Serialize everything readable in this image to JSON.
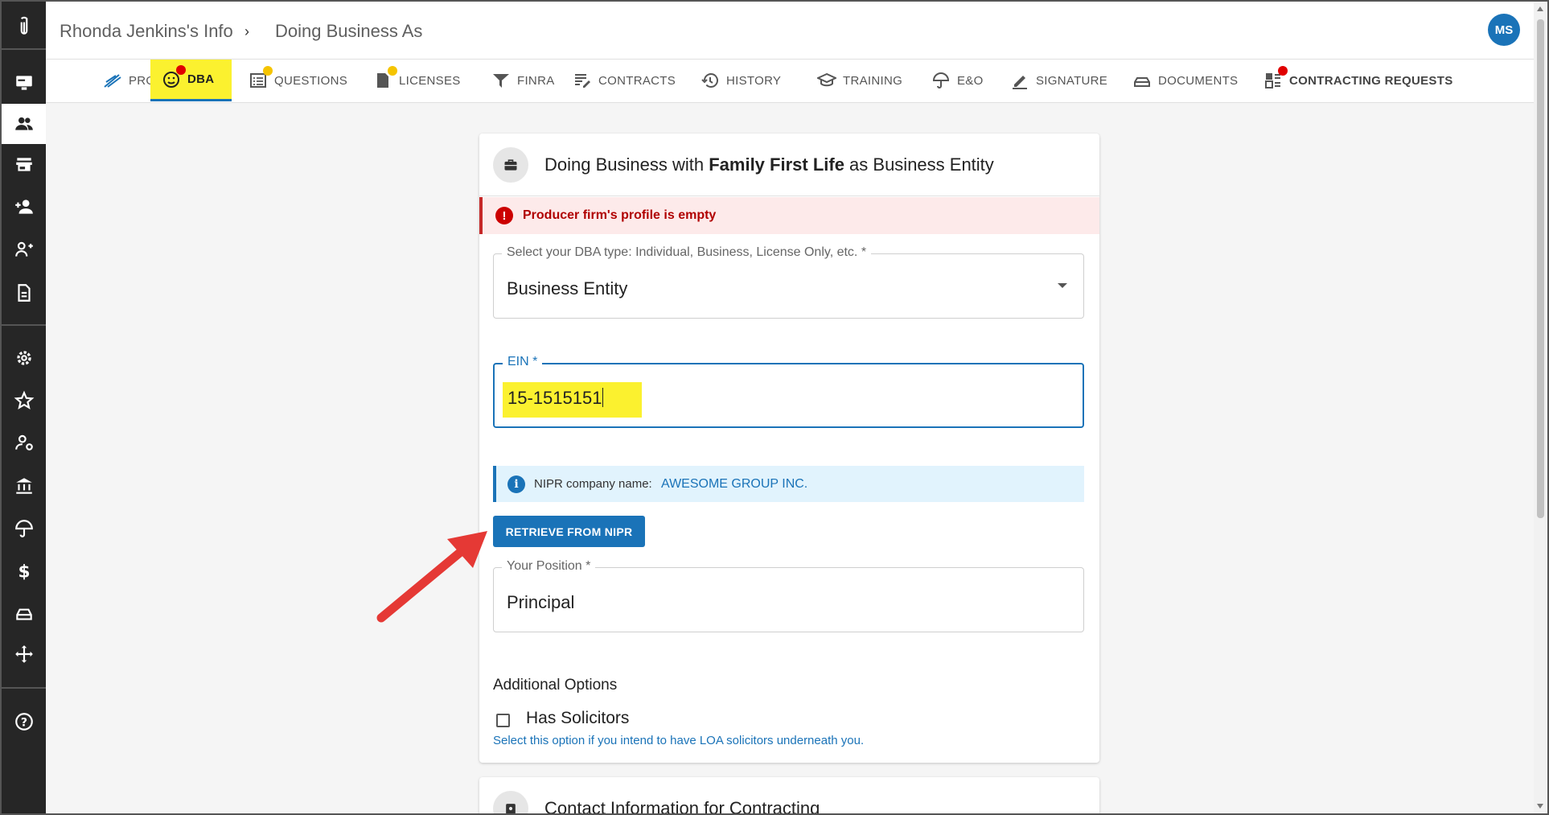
{
  "header": {
    "breadcrumb_parent": "Rhonda Jenkins's Info",
    "breadcrumb_separator": "›",
    "breadcrumb_current": "Doing Business As",
    "avatar_initials": "MS"
  },
  "tabs": [
    {
      "label": "PROFILE",
      "icon": "profile-icon"
    },
    {
      "label": "DBA",
      "icon": "dba-icon",
      "active": true,
      "badge": "red"
    },
    {
      "label": "QUESTIONS",
      "icon": "questions-icon",
      "badge": "yellow"
    },
    {
      "label": "LICENSES",
      "icon": "licenses-icon",
      "badge": "yellow"
    },
    {
      "label": "FINRA",
      "icon": "finra-icon"
    },
    {
      "label": "CONTRACTS",
      "icon": "contracts-icon"
    },
    {
      "label": "HISTORY",
      "icon": "history-icon"
    },
    {
      "label": "TRAINING",
      "icon": "training-icon"
    },
    {
      "label": "E&O",
      "icon": "umbrella-icon"
    },
    {
      "label": "SIGNATURE",
      "icon": "signature-icon"
    },
    {
      "label": "DOCUMENTS",
      "icon": "documents-icon"
    },
    {
      "label": "CONTRACTING REQUESTS",
      "icon": "contracting-requests-icon",
      "badge": "red"
    }
  ],
  "sidebar": {
    "items": [
      "logo-icon",
      "dashboard-icon",
      "people-icon",
      "store-icon",
      "add-person-icon",
      "group-add-icon",
      "document-icon",
      "settings-icon",
      "star-icon",
      "user-settings-icon",
      "bank-icon",
      "umbrella-icon",
      "dollar-icon",
      "inbox-icon",
      "move-icon",
      "help-icon"
    ]
  },
  "dba_card": {
    "title_prefix": "Doing Business with ",
    "title_bold": "Family First Life",
    "title_suffix": " as Business Entity",
    "error_text": "Producer firm's profile is empty",
    "dba_type_label": "Select your DBA type: Individual, Business, License Only, etc. *",
    "dba_type_value": "Business Entity",
    "ein_label": "EIN *",
    "ein_value": "15-1515151",
    "nipr_label": "NIPR company name:",
    "nipr_value": "AWESOME GROUP INC.",
    "retrieve_button": "RETRIEVE FROM NIPR",
    "position_label": "Your Position *",
    "position_value": "Principal",
    "additional_title": "Additional Options",
    "has_solicitors_label": "Has Solicitors",
    "has_solicitors_checked": false,
    "has_solicitors_hint": "Select this option if you intend to have LOA solicitors underneath you."
  },
  "contact_card": {
    "title": "Contact Information for Contracting"
  },
  "colors": {
    "accent": "#1a73b8",
    "highlight": "#fbf12f",
    "error": "#c62828",
    "arrow": "#e53935",
    "sidebar": "#262626"
  }
}
